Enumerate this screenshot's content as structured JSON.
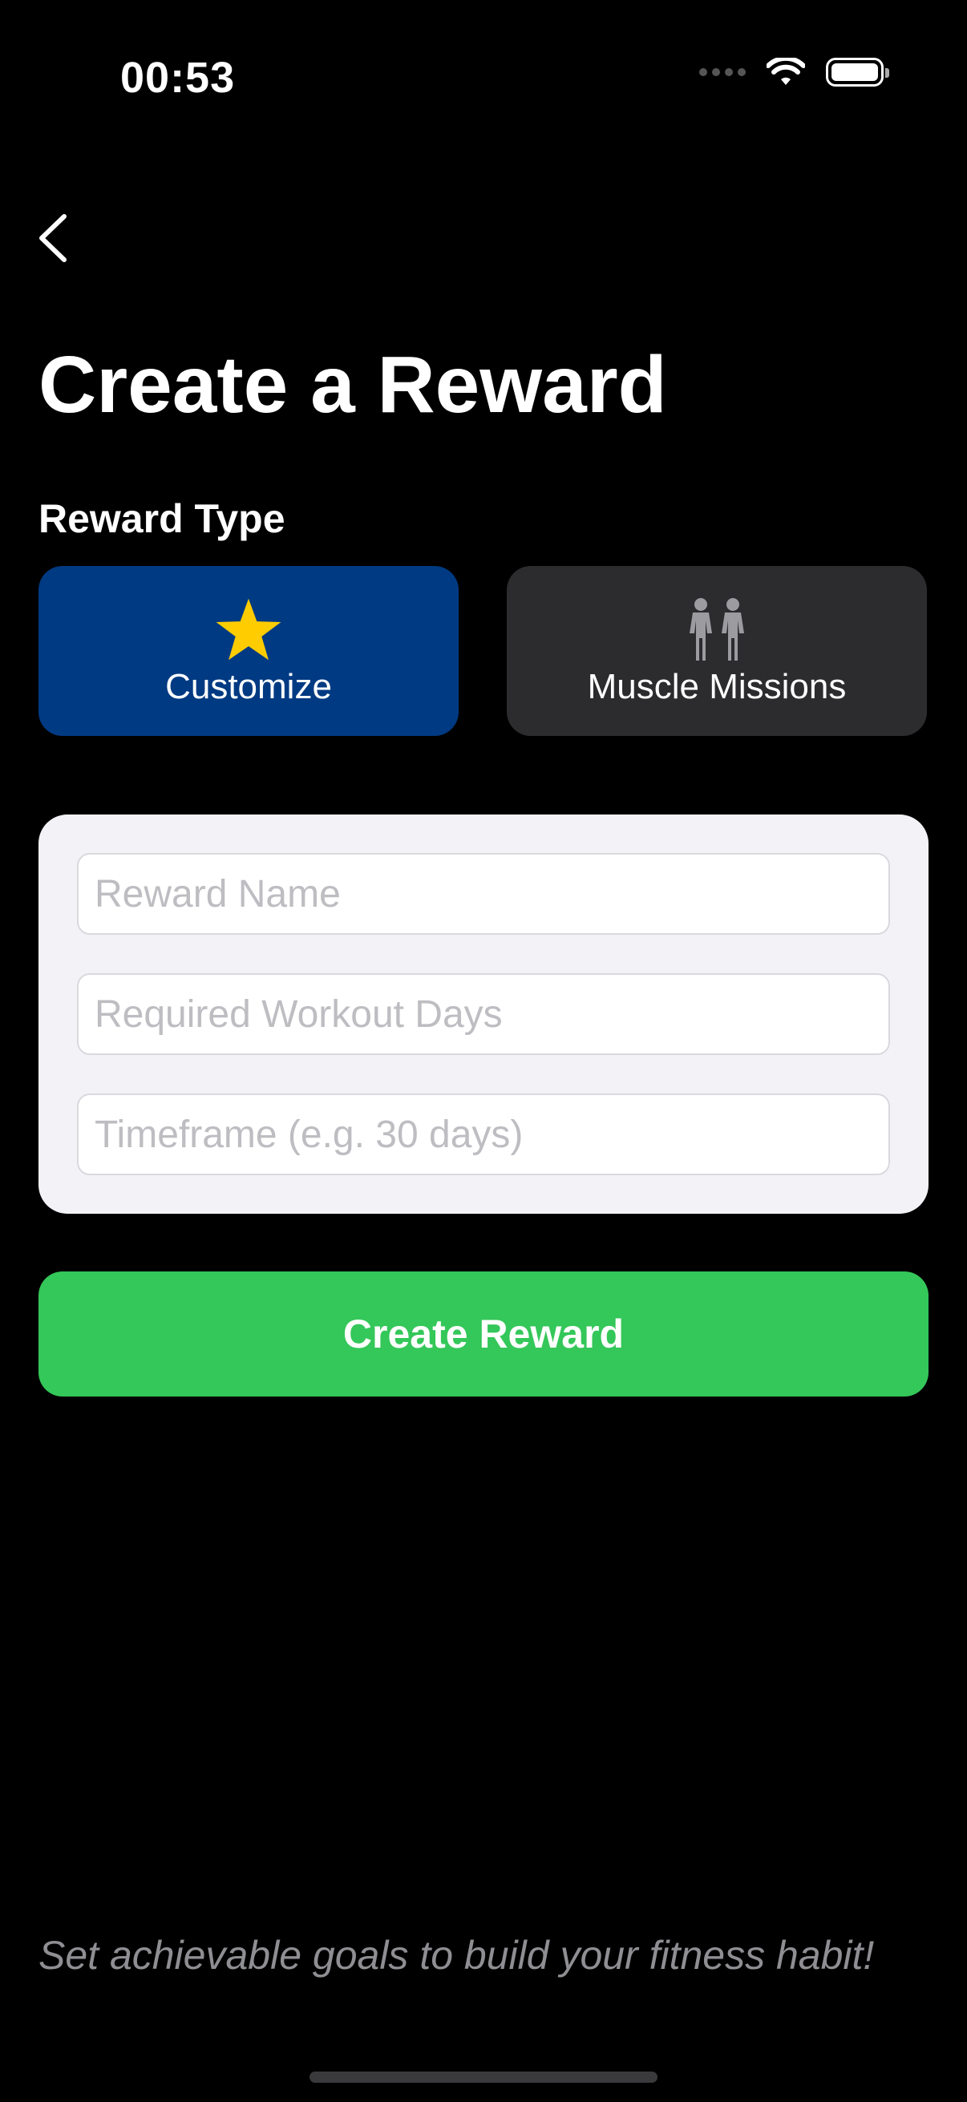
{
  "status_bar": {
    "time": "00:53"
  },
  "header": {
    "title": "Create a Reward"
  },
  "reward_type": {
    "label": "Reward Type",
    "options": [
      {
        "label": "Customize",
        "icon": "star-icon",
        "selected": true
      },
      {
        "label": "Muscle Missions",
        "icon": "people-icon",
        "selected": false
      }
    ]
  },
  "form": {
    "reward_name": {
      "value": "",
      "placeholder": "Reward Name"
    },
    "required_days": {
      "value": "",
      "placeholder": "Required Workout Days"
    },
    "timeframe": {
      "value": "",
      "placeholder": "Timeframe (e.g. 30 days)"
    }
  },
  "actions": {
    "create_label": "Create Reward"
  },
  "footer": {
    "tip": "Set achievable goals to build your fitness habit!"
  },
  "colors": {
    "selected_bg": "#003A82",
    "unselected_bg": "#2C2C2E",
    "accent_green": "#34C759",
    "star": "#FFCC00"
  }
}
